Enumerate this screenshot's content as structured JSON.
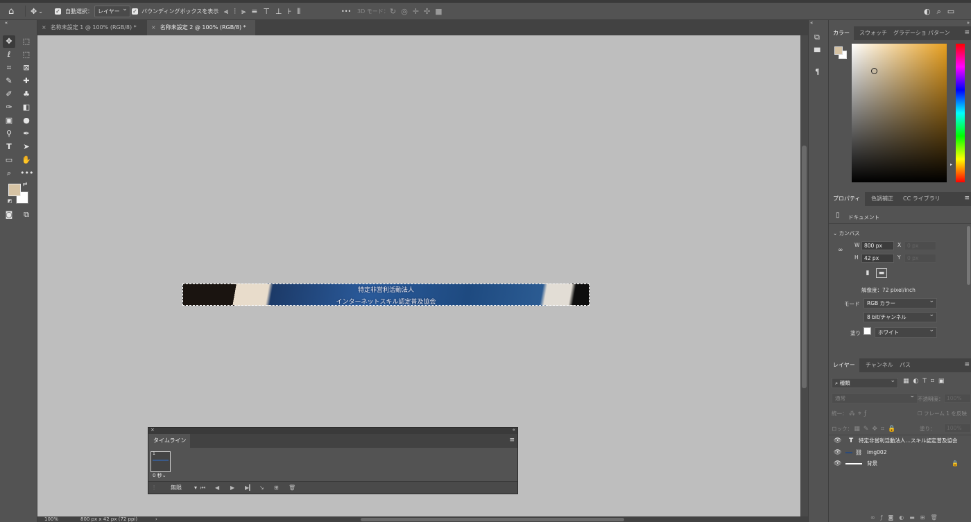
{
  "colors": {
    "foreground": "#d6c3a4",
    "background": "#ffffff",
    "hue_indicator": "#e8a020"
  },
  "optbar": {
    "home_icon": "home-icon",
    "auto_select_label": "自動選択：",
    "auto_select_value": "レイヤー",
    "bbox_label": "バウンディングボックスを表示",
    "more": "•••",
    "mode3d_label": "3D モード："
  },
  "tabs": [
    {
      "label": "名称未設定 1 @ 100% (RGB/8) *"
    },
    {
      "label": "名称未設定 2 @ 100% (RGB/8) *"
    }
  ],
  "document": {
    "line1": "特定非営利活動法人",
    "line2": "インターネットスキル認定普及協会"
  },
  "status": {
    "zoom": "100%",
    "info": "800 px x 42 px (72 ppi)",
    "arrow": "›"
  },
  "timeline": {
    "title": "タイムライン",
    "frame_number": "1",
    "frame_delay": "0 秒",
    "loop": "無限"
  },
  "color_panel": {
    "tabs": [
      "カラー",
      "スウォッチ",
      "グラデーショ",
      "パターン"
    ]
  },
  "properties_panel": {
    "tabs": [
      "プロパティ",
      "色調補正",
      "CC ライブラリ"
    ],
    "doc_label": "ドキュメント",
    "canvas_label": "カンバス",
    "w_label": "W",
    "w_value": "800 px",
    "h_label": "H",
    "h_value": "42 px",
    "x_label": "X",
    "x_value": "0 px",
    "y_label": "Y",
    "y_value": "0 px",
    "resolution": "解像度：72 pixel/inch",
    "mode_label": "モード",
    "mode_value": "RGB カラー",
    "depth_value": "8 bit/チャンネル",
    "fill_label": "塗り",
    "fill_value": "ホワイト"
  },
  "layers_panel": {
    "tabs": [
      "レイヤー",
      "チャンネル",
      "パス"
    ],
    "filter": "種類",
    "blend": "通常",
    "opacity_label": "不透明度：",
    "opacity_value": "100%",
    "unify_label": "統一：",
    "propagate_label": "フレーム 1 を反映",
    "lock_label": "ロック：",
    "fill_label": "塗り：",
    "fill_value": "100%",
    "layers": [
      {
        "name": "特定非営利活動法人…スキル認定普及協会",
        "kind": "T"
      },
      {
        "name": "img002",
        "kind": "image"
      },
      {
        "name": "背景",
        "kind": "background"
      }
    ]
  }
}
